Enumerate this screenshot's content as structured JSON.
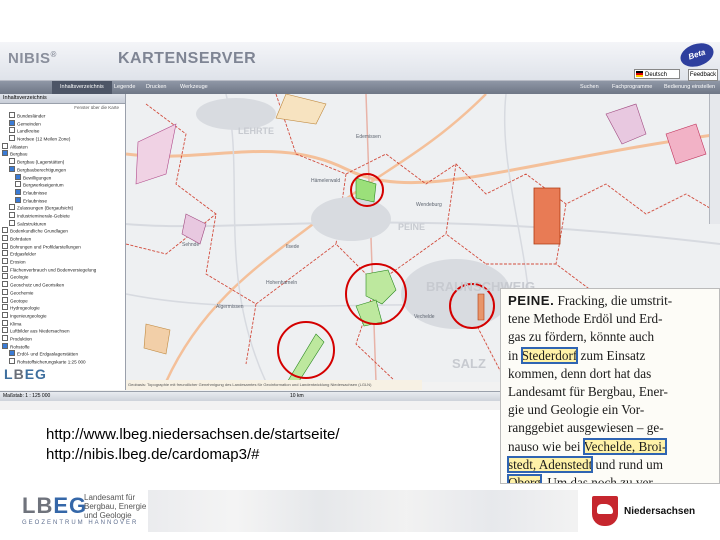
{
  "app": {
    "brand": "NIBIS",
    "brand_mark": "®",
    "title": "KARTENSERVER",
    "beta_badge": "Beta",
    "language": "Deutsch",
    "feedback": "Feedback",
    "nav": [
      "Inhaltsverzeichnis",
      "Legende",
      "Drucken",
      "Werkzeuge",
      "Suchen",
      "Fachprogramme",
      "Bedienung einstellen"
    ],
    "active_tab": "Inhaltsverzeichnis"
  },
  "sidebar": {
    "header": "Inhaltsverzeichnis",
    "filter_link": "Fenster über die Karte",
    "items": [
      {
        "label": "Bundesländer",
        "level": 2,
        "checked": false
      },
      {
        "label": "Gemeinden",
        "level": 2,
        "checked": true
      },
      {
        "label": "Landkreise",
        "level": 2,
        "checked": false
      },
      {
        "label": "Nordsee (12 Meilen Zone)",
        "level": 2,
        "checked": false
      },
      {
        "label": "Altlasten",
        "level": 1,
        "checked": false
      },
      {
        "label": "Bergbau",
        "level": 1,
        "checked": true
      },
      {
        "label": "Bergbau (Lagerstätten)",
        "level": 2,
        "checked": false
      },
      {
        "label": "Bergbauberechtigungen",
        "level": 2,
        "checked": true
      },
      {
        "label": "Bewilligungen",
        "level": 3,
        "checked": true
      },
      {
        "label": "Bergwerkseigentum",
        "level": 3,
        "checked": false
      },
      {
        "label": "Erlaubnisse",
        "level": 3,
        "checked": true
      },
      {
        "label": "Erlaubnisse",
        "level": 3,
        "checked": true
      },
      {
        "label": "Zulassungen (Bergaufsicht)",
        "level": 2,
        "checked": false
      },
      {
        "label": "Industrieminerale-Gebiete",
        "level": 2,
        "checked": false
      },
      {
        "label": "Salzstrukturen",
        "level": 2,
        "checked": false
      },
      {
        "label": "Bodenkundliche Grundlagen",
        "level": 1,
        "checked": false
      },
      {
        "label": "Bohrdaten",
        "level": 1,
        "checked": false
      },
      {
        "label": "Bohrungen und Profildarstellungen",
        "level": 1,
        "checked": false
      },
      {
        "label": "Erdgasfelder",
        "level": 1,
        "checked": false
      },
      {
        "label": "Erosion",
        "level": 1,
        "checked": false
      },
      {
        "label": "Flächenverbrauch und Bodenversiegelung",
        "level": 1,
        "checked": false
      },
      {
        "label": "Geologie",
        "level": 1,
        "checked": false
      },
      {
        "label": "Geoschutz und Georisiken",
        "level": 1,
        "checked": false
      },
      {
        "label": "Geochemie",
        "level": 1,
        "checked": false
      },
      {
        "label": "Geotope",
        "level": 1,
        "checked": false
      },
      {
        "label": "Hydrogeologie",
        "level": 1,
        "checked": false
      },
      {
        "label": "Ingenieurgeologie",
        "level": 1,
        "checked": false
      },
      {
        "label": "Klima",
        "level": 1,
        "checked": false
      },
      {
        "label": "Luftbilder aus Niedersachsen",
        "level": 1,
        "checked": false
      },
      {
        "label": "Produktion",
        "level": 1,
        "checked": false
      },
      {
        "label": "Rohstoffe",
        "level": 1,
        "checked": true
      },
      {
        "label": "Erdöl- und Erdgaslagerstätten",
        "level": 2,
        "checked": true
      },
      {
        "label": "Rohstoffsicherungskarte 1:25 000",
        "level": 2,
        "checked": false
      }
    ],
    "logo": "LBEG"
  },
  "map": {
    "labels": [
      "LEHRTE",
      "PEINE",
      "BRAUNSCHWEIG",
      "SALZ"
    ],
    "places": [
      "Ilsede",
      "Sehnde",
      "Hämelerwald",
      "Vechelde",
      "Wendeburg",
      "Edemissen",
      "Algermissen",
      "Hohenhameln"
    ],
    "copyright": "Geobasis: Topographie mit freundlicher Genehmigung des Landesamtes für Geoinformation und Landentwicklung Niedersachsen (LGLN)",
    "status_scale": "Maßstab: 1 : 125 000",
    "scale_bar": "10 km"
  },
  "clipping": {
    "lead": "PEINE.",
    "line1": " Fracking, die umstrit-",
    "line2": "tene Methode Erdöl und Erd-",
    "line3": "gas zu fördern, könnte auch",
    "line4a": "in ",
    "hl1": "Stederdorf",
    "line4b": " zum Einsatz",
    "line5": "kommen, denn dort hat das",
    "line6": "Landesamt für Bergbau, Ener-",
    "line7": "gie und Geologie ein Vor-",
    "line8": "ranggebiet ausgewiesen – ge-",
    "line9a": "nauso wie bei ",
    "hl2": "Vechelde, Broi-",
    "hl3": "stedt, Adenstedt",
    "line10b": " und rund um",
    "hl4": "Oberg",
    "line11b": ". Um das noch zu ver-"
  },
  "links": {
    "url1": "http://www.lbeg.niedersachsen.de/startseite/",
    "url2": "http://nibis.lbeg.de/cardomap3/#"
  },
  "footer": {
    "logo_main": "LB",
    "logo_accent": "EG",
    "institution_line1": "Landesamt für",
    "institution_line2": "Bergbau, Energie",
    "institution_line3": "und Geologie",
    "subtitle": "GEOZENTRUM HANNOVER",
    "state": "Niedersachsen"
  },
  "colors": {
    "highlight_outline": "#2f64b2",
    "highlight_fill": "#fff2a8",
    "circle_red": "#d40000",
    "lbeg_blue": "#3567a8",
    "niedersachsen_red": "#c6262e"
  }
}
